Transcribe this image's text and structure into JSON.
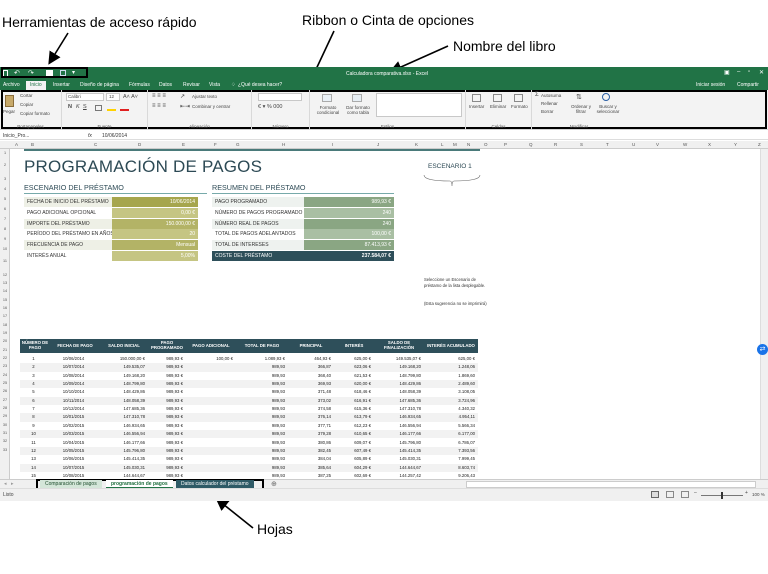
{
  "annotations": {
    "quick_access": "Herramientas de acceso rápido",
    "ribbon": "Ribbon o Cinta de opciones",
    "book_name": "Nombre del libro",
    "sheets": "Hojas"
  },
  "window": {
    "title": "Calculadora comparativa.xlsx - Excel",
    "signin": "Iniciar sesión",
    "share": "Compartir"
  },
  "menu": {
    "items": [
      "Archivo",
      "Inicio",
      "Insertar",
      "Diseño de página",
      "Fórmulas",
      "Datos",
      "Revisar",
      "Vista"
    ],
    "tell_me": "¿Qué desea hacer?"
  },
  "ribbon": {
    "clipboard": {
      "paste": "Pegar",
      "cut": "Cortar",
      "copy": "Copiar",
      "format": "Copiar formato",
      "label": "Portapapeles"
    },
    "font": {
      "name": "Calibri",
      "size": "12",
      "label": "Fuente"
    },
    "alignment": {
      "wrap": "Ajustar texto",
      "merge": "Combinar y centrar",
      "label": "Alineación"
    },
    "number": {
      "label": "Número"
    },
    "styles": {
      "cond": "Formato condicional",
      "table": "Dar formato como tabla",
      "label": "Estilos"
    },
    "cells": {
      "insert": "Insertar",
      "delete": "Eliminar",
      "format": "Formato",
      "label": "Celdas"
    },
    "edit": {
      "autosum": "Autosuma",
      "fill": "Rellenar",
      "clear": "Borrar",
      "sort": "Ordenar y filtrar",
      "find": "Buscar y seleccionar",
      "label": "Modificar"
    }
  },
  "formula_bar": {
    "name_box": "Inicio_Pro...",
    "fx": "fx",
    "value": "10/06/2014"
  },
  "columns": [
    "A",
    "B",
    "C",
    "D",
    "E",
    "F",
    "G",
    "H",
    "I",
    "J",
    "K",
    "L",
    "M",
    "N",
    "O",
    "P",
    "Q",
    "R",
    "S",
    "T",
    "U",
    "V",
    "W",
    "X",
    "Y",
    "Z"
  ],
  "rows": [
    "1",
    "2",
    "3",
    "4",
    "5",
    "6",
    "7",
    "8",
    "9",
    "10",
    "11",
    "12",
    "13",
    "14",
    "15",
    "16",
    "17",
    "18",
    "19",
    "20",
    "21",
    "22",
    "23",
    "24",
    "25",
    "26",
    "27",
    "28",
    "29",
    "30",
    "31",
    "32",
    "33"
  ],
  "sheet": {
    "title": "PROGRAMACIÓN DE PAGOS",
    "scenario": "ESCENARIO 1",
    "loan_section": "ESCENARIO DEL PRÉSTAMO",
    "summary_section": "RESUMEN DEL PRÉSTAMO",
    "loan": [
      {
        "label": "FECHA DE INICIO DEL PRÉSTAMO",
        "value": "10/06/2014"
      },
      {
        "label": "PAGO ADICIONAL OPCIONAL",
        "value": "0,00 €"
      },
      {
        "label": "IMPORTE DEL PRÉSTAMO",
        "value": "150.000,00 €"
      },
      {
        "label": "PERÍODO DEL PRÉSTAMO EN AÑOS",
        "value": "20"
      },
      {
        "label": "FRECUENCIA DE PAGO",
        "value": "Mensual"
      },
      {
        "label": "INTERÉS ANUAL",
        "value": "5,00%"
      }
    ],
    "summary": [
      {
        "label": "PAGO PROGRAMADO",
        "value": "989,93 €"
      },
      {
        "label": "NÚMERO DE PAGOS PROGRAMADO",
        "value": "240"
      },
      {
        "label": "NÚMERO REAL DE PAGOS",
        "value": "240"
      },
      {
        "label": "TOTAL DE PAGOS ADELANTADOS",
        "value": "100,00 €"
      },
      {
        "label": "TOTAL DE INTERESES",
        "value": "87.413,93 €"
      },
      {
        "label": "COSTE DEL PRÉSTAMO",
        "value": "237.584,07 €"
      }
    ],
    "note1": "Seleccione un Escenario de préstamo de la lista desplegable.",
    "note2": "(Esta sugerencia no se imprimirá)",
    "headers": [
      "NÚMERO DE PAGO",
      "FECHA DE PAGO",
      "SALDO INICIAL",
      "PAGO PROGRAMADO",
      "PAGO ADICIONAL",
      "TOTAL DE PAGO",
      "PRINCIPAL",
      "INTERÉS",
      "SALDO DE FINALIZACIÓN",
      "INTERÉS ACUMULADO"
    ],
    "table": [
      [
        "1",
        "10/06/2014",
        "150.000,00 €",
        "989,93 €",
        "100,00 €",
        "1.089,93 €",
        "464,93 €",
        "625,00 €",
        "149.535,07 €",
        "625,00 €"
      ],
      [
        "2",
        "10/07/2014",
        "149.535,07",
        "989,93 €",
        "",
        "989,93",
        "366,87",
        "623,06 €",
        "149.168,20",
        "1.248,06"
      ],
      [
        "3",
        "10/08/2014",
        "149.168,20",
        "989,93 €",
        "",
        "989,93",
        "368,40",
        "621,53 €",
        "148.799,80",
        "1.869,60"
      ],
      [
        "4",
        "10/09/2014",
        "148.799,80",
        "989,93 €",
        "",
        "989,93",
        "369,93",
        "620,00 €",
        "148.429,86",
        "2.489,60"
      ],
      [
        "5",
        "10/10/2014",
        "148.429,86",
        "989,93 €",
        "",
        "989,93",
        "371,48",
        "618,46 €",
        "148.058,39",
        "3.108,05"
      ],
      [
        "6",
        "10/11/2014",
        "148.058,39",
        "989,93 €",
        "",
        "989,93",
        "373,02",
        "616,91 €",
        "147.685,36",
        "3.724,96"
      ],
      [
        "7",
        "10/12/2014",
        "147.685,36",
        "989,93 €",
        "",
        "989,93",
        "374,58",
        "615,36 €",
        "147.310,78",
        "4.340,32"
      ],
      [
        "8",
        "10/01/2015",
        "147.310,78",
        "989,93 €",
        "",
        "989,93",
        "376,14",
        "613,79 €",
        "146.934,65",
        "4.954,11"
      ],
      [
        "9",
        "10/02/2015",
        "146.934,65",
        "989,93 €",
        "",
        "989,93",
        "377,71",
        "612,23 €",
        "146.556,94",
        "5.566,34"
      ],
      [
        "10",
        "10/03/2015",
        "146.556,94",
        "989,93 €",
        "",
        "989,93",
        "379,28",
        "610,65 €",
        "146.177,66",
        "6.177,00"
      ],
      [
        "11",
        "10/04/2015",
        "146.177,66",
        "989,93 €",
        "",
        "989,93",
        "380,86",
        "609,07 €",
        "145.796,80",
        "6.786,07"
      ],
      [
        "12",
        "10/05/2015",
        "145.796,80",
        "989,93 €",
        "",
        "989,93",
        "382,45",
        "607,49 €",
        "145.414,35",
        "7.393,56"
      ],
      [
        "13",
        "10/06/2015",
        "145.414,35",
        "989,93 €",
        "",
        "989,93",
        "384,04",
        "605,89 €",
        "145.030,31",
        "7.999,45"
      ],
      [
        "14",
        "10/07/2015",
        "145.030,31",
        "989,93 €",
        "",
        "989,93",
        "385,64",
        "604,29 €",
        "144.644,67",
        "8.603,74"
      ],
      [
        "15",
        "10/08/2015",
        "144.644,67",
        "989,93 €",
        "",
        "989,93",
        "387,25",
        "602,69 €",
        "144.257,42",
        "9.206,43"
      ],
      [
        "16",
        "10/09/2015",
        "144.257,42",
        "989,93 €",
        "",
        "989,93",
        "388,86",
        "601,07 €",
        "143.868,56",
        "9.807,50"
      ],
      [
        "17",
        "10/10/2015",
        "143.868,56",
        "989,93 €",
        "",
        "989,93",
        "390,48",
        "599,45 €",
        "143.478,08",
        "10.406,95"
      ],
      [
        "18",
        "10/11/2015",
        "143.478,08",
        "989,93 €",
        "",
        "989,93",
        "392,11",
        "597,83 €",
        "143.085,97",
        "11.004,78"
      ],
      [
        "19",
        "10/12/2015",
        "143.085,97",
        "989,93 €",
        "",
        "989,93",
        "393,74",
        "596,19 €",
        "142.692,23",
        "11.600,97"
      ],
      [
        "20",
        "10/01/2016",
        "142.692,23",
        "989,93 €",
        "",
        "989,93",
        "395,38",
        "594,55 €",
        "142.296,85",
        "12.195,52"
      ],
      [
        "21",
        "10/02/2016",
        "142.296,85",
        "989,93 €",
        "",
        "989,93",
        "397,03",
        "592,90 €",
        "141.899,82",
        "12.788,42"
      ],
      [
        "22",
        "10/03/2016",
        "141.899,82",
        "989,93 €",
        "",
        "989,93",
        "398,68",
        "591,25 €",
        "141.501,13",
        "13.379,67"
      ]
    ]
  },
  "tabs": [
    "Comparación de pagos",
    "programación de pagos",
    "Datos calculador del préstamo"
  ],
  "status": {
    "ready": "Listo",
    "zoom": "100 %"
  },
  "colors": {
    "excel_green": "#217346",
    "dark_teal": "#2e4f5a",
    "olive": "#a6a64d",
    "sage": "#8aa683"
  }
}
